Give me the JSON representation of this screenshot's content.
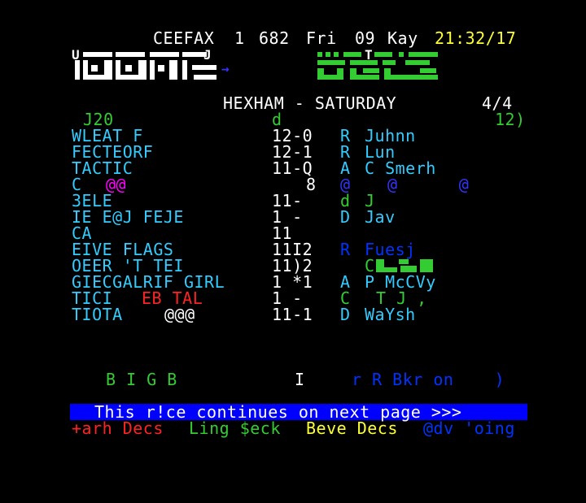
{
  "header": {
    "service": "CEEFAX",
    "channel": "1",
    "page": "682",
    "day": "Fri",
    "date": "09",
    "month": "Kay",
    "time": "21:32/17"
  },
  "logo": {
    "bbc_u": "U",
    "bbc_j": "J",
    "sport_t": "T"
  },
  "title": {
    "venue": "HEXHAM - SATURDAY",
    "page_count": "4/4"
  },
  "race": {
    "time": "J20",
    "going": "d",
    "runners": "12)"
  },
  "runners": [
    {
      "name": "WLEAT F",
      "extra": "",
      "odds": "12-0",
      "code": "R",
      "jockey": "Juhnn"
    },
    {
      "name": "FECTEORF",
      "extra": "",
      "odds": "12-1",
      "code": "R",
      "jockey": "Lun"
    },
    {
      "name": "TACTIC",
      "extra": "",
      "odds": "11-Q",
      "code": "A",
      "jockey": "C Smerh"
    },
    {
      "name": "C",
      "extra": "@@",
      "odds": "8",
      "code": "@",
      "jockey": "@      @"
    },
    {
      "name": "3ELE",
      "extra": "",
      "odds": "11-",
      "code": "d",
      "jockey": "J"
    },
    {
      "name": "IE E@J FEJE",
      "extra": "",
      "odds": "1 -",
      "code": "D",
      "jockey": "Jav"
    },
    {
      "name": "CA",
      "extra": "",
      "odds": "11",
      "code": "",
      "jockey": ""
    },
    {
      "name": "EIVE FLAGS",
      "extra": "",
      "odds": "11I2",
      "code": "R",
      "jockey": "Fuesj"
    },
    {
      "name": "OEER 'T TEI",
      "extra": "",
      "odds": "11)2",
      "code": "",
      "jockey": "C"
    },
    {
      "name": "GIECGALRIF GIRL",
      "extra": "",
      "odds": "1 *1",
      "code": "A",
      "jockey": "P McCVy"
    },
    {
      "name": "TICI",
      "extra": "EB TAL",
      "odds": "1 -",
      "code": "C",
      "jockey": "T J ,"
    },
    {
      "name": "TIOTA",
      "extra": "@@@",
      "odds": "11-1",
      "code": "D",
      "jockey": "WaYsh"
    }
  ],
  "footer_line": {
    "left": "B I G B",
    "mid": "I",
    "right": "r R Bkr on    )"
  },
  "banner": "This r!ce continues on next page >>>",
  "fastext": {
    "red": "+arh Decs",
    "green": "Ling $eck",
    "yellow": "Beve Decs",
    "cyan": "@dv 'oing"
  },
  "colors": {
    "white": "#ffffff",
    "cyan": "#33ccff",
    "green": "#33cc33",
    "yellow": "#ffff33",
    "magenta": "#ff00ff",
    "red": "#ff2222",
    "blue": "#0000ff"
  }
}
